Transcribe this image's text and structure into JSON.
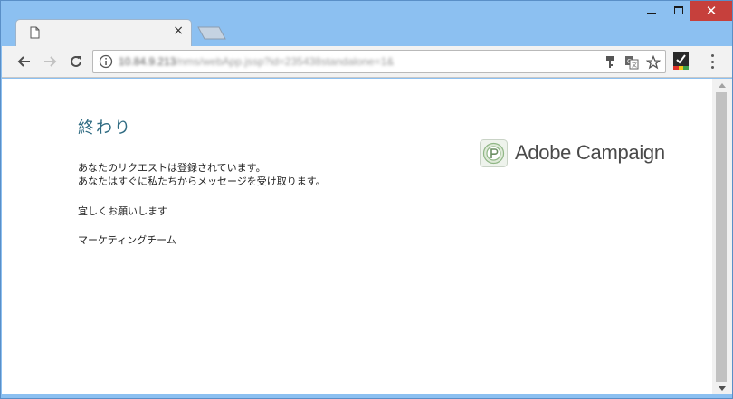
{
  "browser": {
    "tab_close_glyph": "×",
    "window_close_glyph": "✕",
    "url_host": "10.84.9.213",
    "url_path": "/nms/webApp.jssp?id=235438standalone=1&",
    "colors": {
      "titlebar": "#8cc0f1",
      "close_button": "#c6403c"
    }
  },
  "page": {
    "title": "終わり",
    "lines": [
      "あなたのリクエストは登録されています。",
      "あなたはすぐに私たちからメッセージを受け取ります。",
      "宜しくお願いします",
      "マーケティングチーム"
    ],
    "brand_name": "Adobe Campaign",
    "title_color": "#2f6b82"
  }
}
